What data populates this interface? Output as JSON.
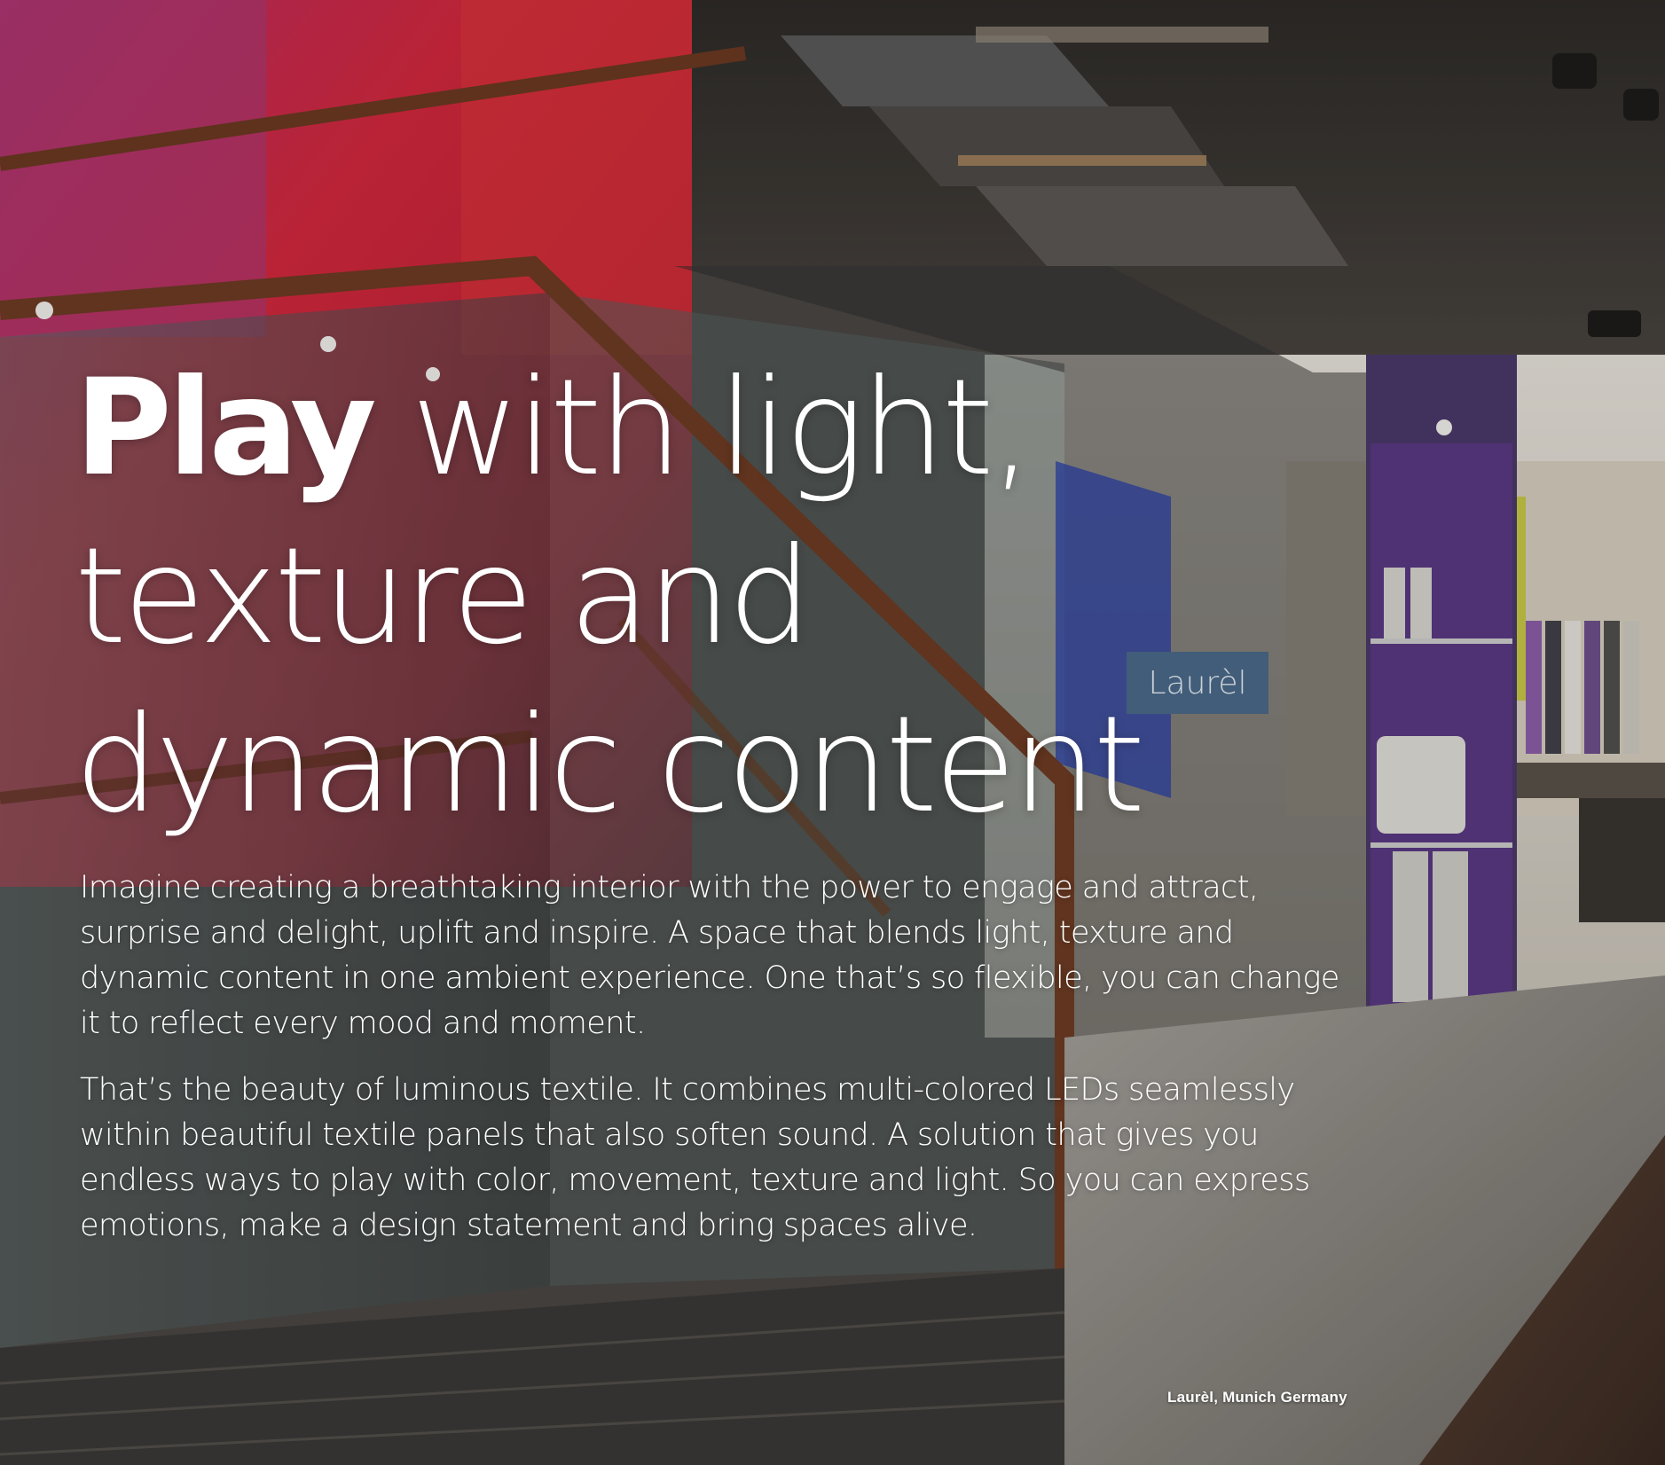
{
  "headline": {
    "strong": "Play",
    "rest_line1": " with light,",
    "line2": "texture and",
    "line3": "dynamic content"
  },
  "body": {
    "paragraph1": "Imagine creating a breathtaking interior with the power to engage and attract, surprise and delight, uplift and inspire. A space that blends light, texture and dynamic content in one ambient experience. One that’s so flexible, you can change it to reflect every mood and moment.",
    "paragraph2": "That’s the beauty of luminous textile. It combines multi-colored LEDs seamlessly within beautiful textile panels that also soften sound. A solution that gives you endless ways to play with color, movement, texture and light. So you can express emotions, make a design statement and bring spaces alive."
  },
  "photo": {
    "sign_text": "Laurèl",
    "caption": "Laurèl, Munich Germany"
  },
  "colors": {
    "red_wall": "#c8243a",
    "magenta": "#b83870",
    "handrail": "#6b3a22",
    "ceiling": "#3a3632",
    "floor": "#8e8a84"
  }
}
